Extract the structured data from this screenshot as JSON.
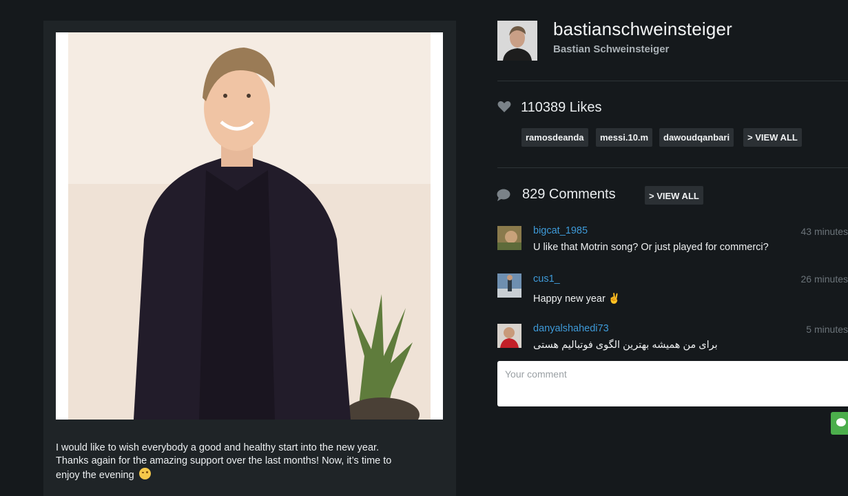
{
  "post": {
    "caption_line1": "I would like to wish everybody a good and healthy start into the new year.",
    "caption_line2": "Thanks again for the amazing support over the last months! Now, it’s time to",
    "caption_line3": "enjoy the evening"
  },
  "profile": {
    "username": "bastianschweinsteiger",
    "full_name": "Bastian Schweinsteiger"
  },
  "likes": {
    "count_label": "110389 Likes",
    "users": [
      "ramosdeanda",
      "messi.10.m",
      "dawoudqanbari"
    ],
    "view_all_label": "> VIEW ALL"
  },
  "comments": {
    "count_label": "829 Comments",
    "view_all_label": "> VIEW ALL",
    "items": [
      {
        "user": "bigcat_1985",
        "time": "43 minutes",
        "text": "U like that Motrin song? Or just played for commerci?"
      },
      {
        "user": "cus1_",
        "time": "26 minutes",
        "text": "Happy new year ✌️"
      },
      {
        "user": "danyalshahedi73",
        "time": "5 minutes",
        "text": "برای من همیشه بهترین الگوی فوتبالیم هستی"
      }
    ],
    "input_placeholder": "Your comment"
  },
  "colors": {
    "background": "#15191c",
    "panel": "#1f2427",
    "link": "#3e9ad8",
    "send_button": "#4cae4c"
  },
  "icons": {
    "likes": "heart-icon",
    "comments": "speech-bubble-icon",
    "send": "send-comment-icon",
    "caption_emoji": "wink-emoji-icon"
  }
}
